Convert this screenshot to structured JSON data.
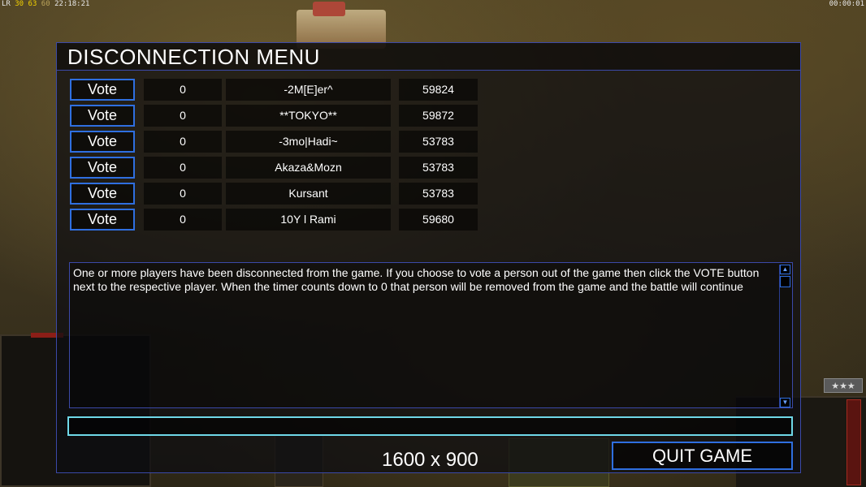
{
  "hud": {
    "left_prefix": "LR",
    "left_fps": "30",
    "left_fps2": "63",
    "left_fps3": "60",
    "left_time": "22:18:21",
    "right_time": "00:00:01"
  },
  "dialog": {
    "title": "DISCONNECTION MENU",
    "vote_label": "Vote",
    "players": [
      {
        "count": "0",
        "name": "-2M[E]er^",
        "ping": "59824"
      },
      {
        "count": "0",
        "name": "**TOKYO**",
        "ping": "59872"
      },
      {
        "count": "0",
        "name": "-3mo|Hadi~",
        "ping": "53783"
      },
      {
        "count": "0",
        "name": "Akaza&Mozn",
        "ping": "53783"
      },
      {
        "count": "0",
        "name": "Kursant",
        "ping": "53783"
      },
      {
        "count": "0",
        "name": "10Y l Rami",
        "ping": "59680"
      }
    ],
    "message": "One or more players have been disconnected from the game. If you choose to vote a person out of the game then click the VOTE button next to the respective player. When the timer counts down to 0 that person will be removed from the game and the battle will continue",
    "chat_value": "",
    "resolution": "1600 x 900",
    "quit_label": "QUIT GAME"
  },
  "background": {
    "stars": "★★★"
  },
  "colors": {
    "border_blue": "#3b49a8",
    "button_blue": "#2f6fe0",
    "chat_cyan": "#6fd8e8",
    "fps_yellow": "#f2d000"
  }
}
